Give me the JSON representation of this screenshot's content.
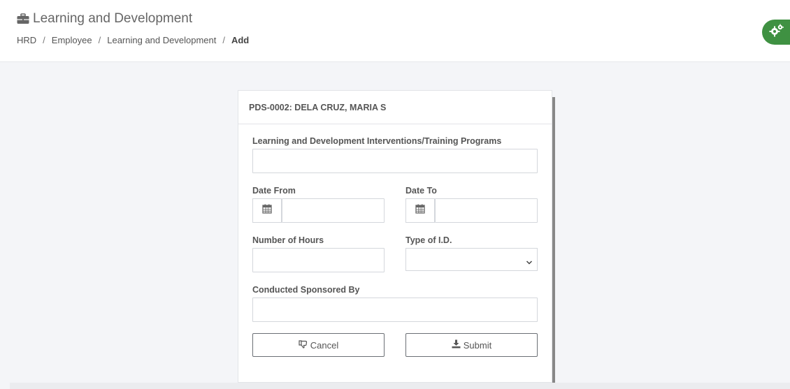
{
  "header": {
    "title": "Learning and Development",
    "title_icon": "briefcase-icon",
    "breadcrumb": [
      "HRD",
      "Employee",
      "Learning and Development"
    ],
    "breadcrumb_active": "Add",
    "separator": "/"
  },
  "settings": {
    "icon": "gears-icon",
    "color": "#3f9142"
  },
  "form": {
    "card_title": "PDS-0002: DELA CRUZ, MARIA S",
    "fields": {
      "training_program": {
        "label": "Learning and Development Interventions/Training Programs",
        "value": ""
      },
      "date_from": {
        "label": "Date From",
        "value": ""
      },
      "date_to": {
        "label": "Date To",
        "value": ""
      },
      "hours": {
        "label": "Number of Hours",
        "value": ""
      },
      "id_type": {
        "label": "Type of I.D.",
        "value": ""
      },
      "sponsored_by": {
        "label": "Conducted Sponsored By",
        "value": ""
      }
    },
    "buttons": {
      "cancel": "Cancel",
      "submit": "Submit"
    }
  }
}
